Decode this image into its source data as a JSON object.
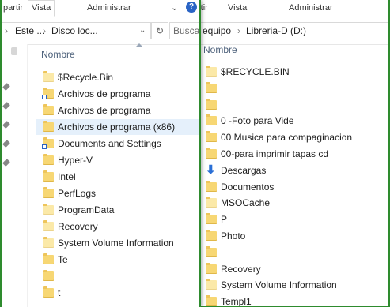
{
  "front": {
    "ribbon": {
      "tab_share": "partir",
      "tab_view": "Vista",
      "tab_manage": "Administrar"
    },
    "address": {
      "parts": [
        "Este ...",
        "Disco loc..."
      ],
      "search_placeholder": "Busca"
    },
    "column_name": "Nombre",
    "items": [
      {
        "label": "$Recycle.Bin",
        "icon": "folder-pale"
      },
      {
        "label": "Archivos de programa",
        "icon": "folder-shortcut"
      },
      {
        "label": "Archivos de programa",
        "icon": "folder"
      },
      {
        "label": "Archivos de programa (x86)",
        "icon": "folder",
        "selected": true
      },
      {
        "label": "Documents and Settings",
        "icon": "folder-shortcut"
      },
      {
        "label": "Hyper-V",
        "icon": "folder"
      },
      {
        "label": "Intel",
        "icon": "folder"
      },
      {
        "label": "PerfLogs",
        "icon": "folder"
      },
      {
        "label": "ProgramData",
        "icon": "folder-pale"
      },
      {
        "label": "Recovery",
        "icon": "folder-pale"
      },
      {
        "label": "System Volume Information",
        "icon": "folder-pale"
      },
      {
        "label": "Te",
        "icon": "folder"
      },
      {
        "label": "",
        "icon": "folder"
      },
      {
        "label": "t",
        "icon": "folder"
      }
    ]
  },
  "back": {
    "ribbon": {
      "tab_share": "rtir",
      "tab_view": "Vista",
      "tab_manage": "Administrar"
    },
    "address": {
      "parts": [
        "equipo",
        "Libreria-D (D:)"
      ]
    },
    "column_name": "Nombre",
    "items": [
      {
        "label": "$RECYCLE.BIN",
        "icon": "folder-pale"
      },
      {
        "label": "",
        "icon": "folder"
      },
      {
        "label": "",
        "icon": "folder"
      },
      {
        "label": "0 -Foto para Vide",
        "icon": "folder"
      },
      {
        "label": "00 Musica para compaginacion",
        "icon": "folder"
      },
      {
        "label": "00-para imprimir tapas cd",
        "icon": "folder"
      },
      {
        "label": "Descargas",
        "icon": "download-arrow"
      },
      {
        "label": "Documentos",
        "icon": "folder"
      },
      {
        "label": "MSOCache",
        "icon": "folder-pale"
      },
      {
        "label": "P",
        "icon": "folder"
      },
      {
        "label": "Photo",
        "icon": "folder"
      },
      {
        "label": "",
        "icon": "folder"
      },
      {
        "label": "Recovery",
        "icon": "folder"
      },
      {
        "label": "System Volume Information",
        "icon": "folder-pale"
      },
      {
        "label": "Templ1",
        "icon": "folder"
      }
    ]
  },
  "colors": {
    "border_green": "#2e8b2e",
    "selection": "#e5f0fb",
    "folder": "#f7d774",
    "header_text": "#4c607a",
    "help_blue": "#2a64c5"
  }
}
